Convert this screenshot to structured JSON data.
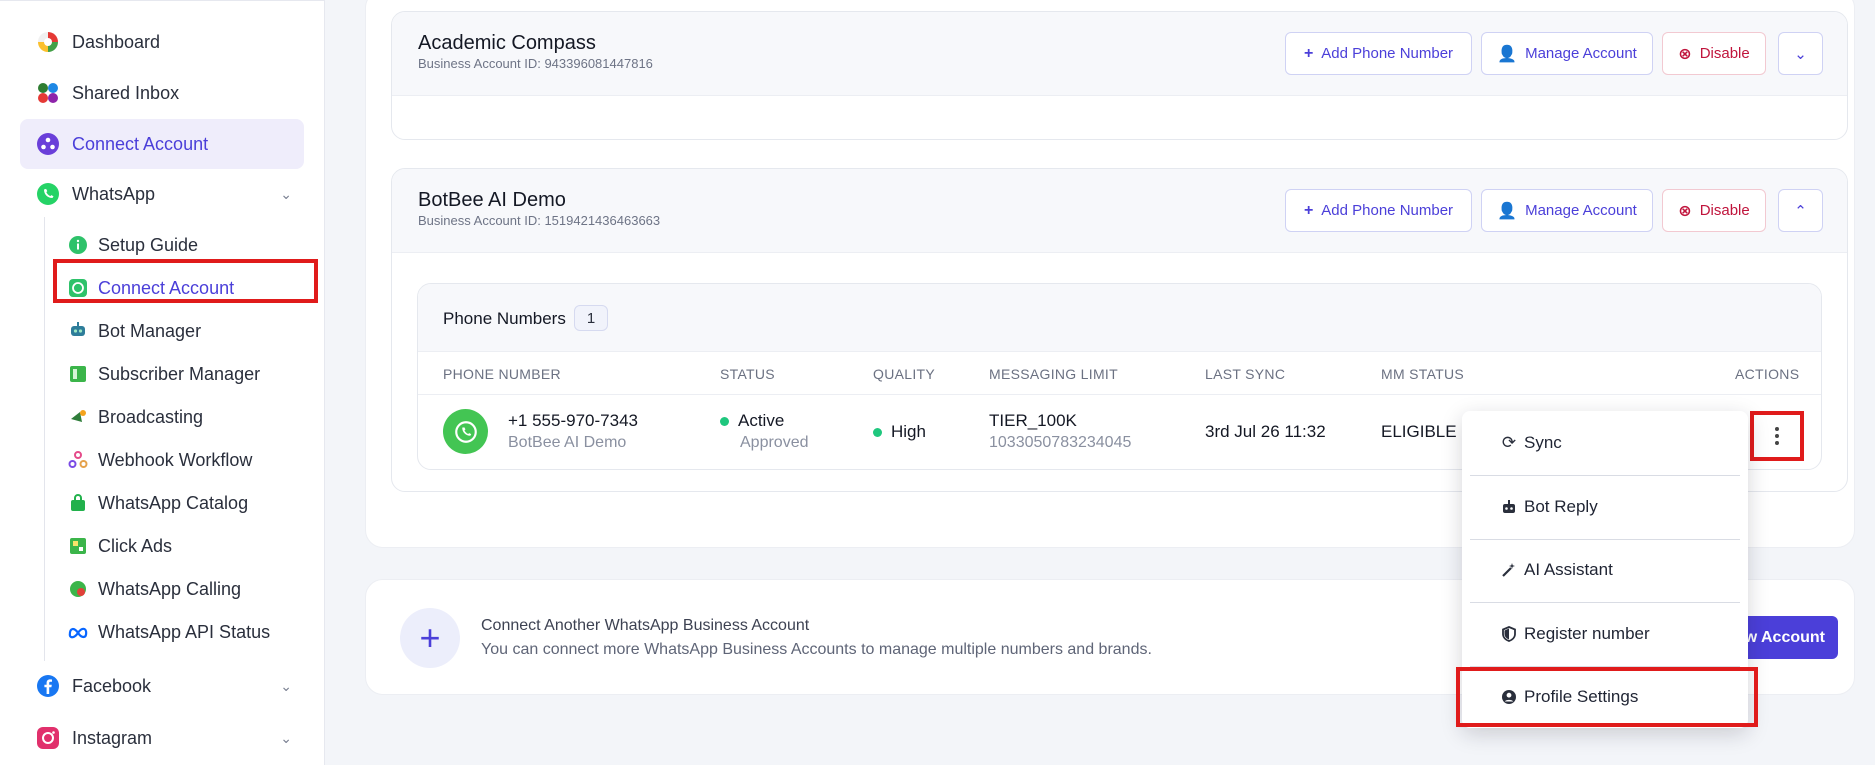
{
  "sidebar": {
    "dashboard": "Dashboard",
    "shared_inbox": "Shared Inbox",
    "connect_account_top": "Connect Account",
    "whatsapp": "WhatsApp",
    "sub": {
      "setup_guide": "Setup Guide",
      "connect_account": "Connect Account",
      "bot_manager": "Bot Manager",
      "subscriber_manager": "Subscriber Manager",
      "broadcasting": "Broadcasting",
      "webhook_workflow": "Webhook Workflow",
      "whatsapp_catalog": "WhatsApp Catalog",
      "click_ads": "Click Ads",
      "whatsapp_calling": "WhatsApp Calling",
      "whatsapp_api_status": "WhatsApp API Status"
    },
    "facebook": "Facebook",
    "instagram": "Instagram"
  },
  "accounts": [
    {
      "name": "Academic Compass",
      "id_label": "Business Account ID: 943396081447816"
    },
    {
      "name": "BotBee AI Demo",
      "id_label": "Business Account ID: 1519421436463663"
    }
  ],
  "buttons": {
    "add_phone": "Add Phone Number",
    "manage": "Manage Account",
    "disable": "Disable"
  },
  "phone_numbers": {
    "title": "Phone Numbers",
    "count": "1",
    "columns": [
      "PHONE NUMBER",
      "STATUS",
      "QUALITY",
      "MESSAGING LIMIT",
      "LAST SYNC",
      "MM STATUS",
      "ACTIONS"
    ],
    "row": {
      "number": "+1 555-970-7343",
      "name": "BotBee AI Demo",
      "status": "Active",
      "status_sub": "Approved",
      "quality": "High",
      "limit": "TIER_100K",
      "limit_id": "1033050783234045",
      "last_sync": "3rd Jul 26 11:32",
      "mm_status": "ELIGIBLE"
    }
  },
  "connect_another": {
    "title": "Connect Another WhatsApp Business Account",
    "desc": "You can connect more WhatsApp Business Accounts to manage multiple numbers and brands.",
    "button_visible": "ew Account"
  },
  "menu": {
    "sync": "Sync",
    "bot_reply": "Bot Reply",
    "ai_assistant": "AI Assistant",
    "register": "Register number",
    "profile": "Profile Settings"
  },
  "colors": {
    "accent": "#4b3fd9",
    "danger": "#c0143c",
    "highlight": "#e01b1b",
    "whatsapp": "#43c553"
  }
}
